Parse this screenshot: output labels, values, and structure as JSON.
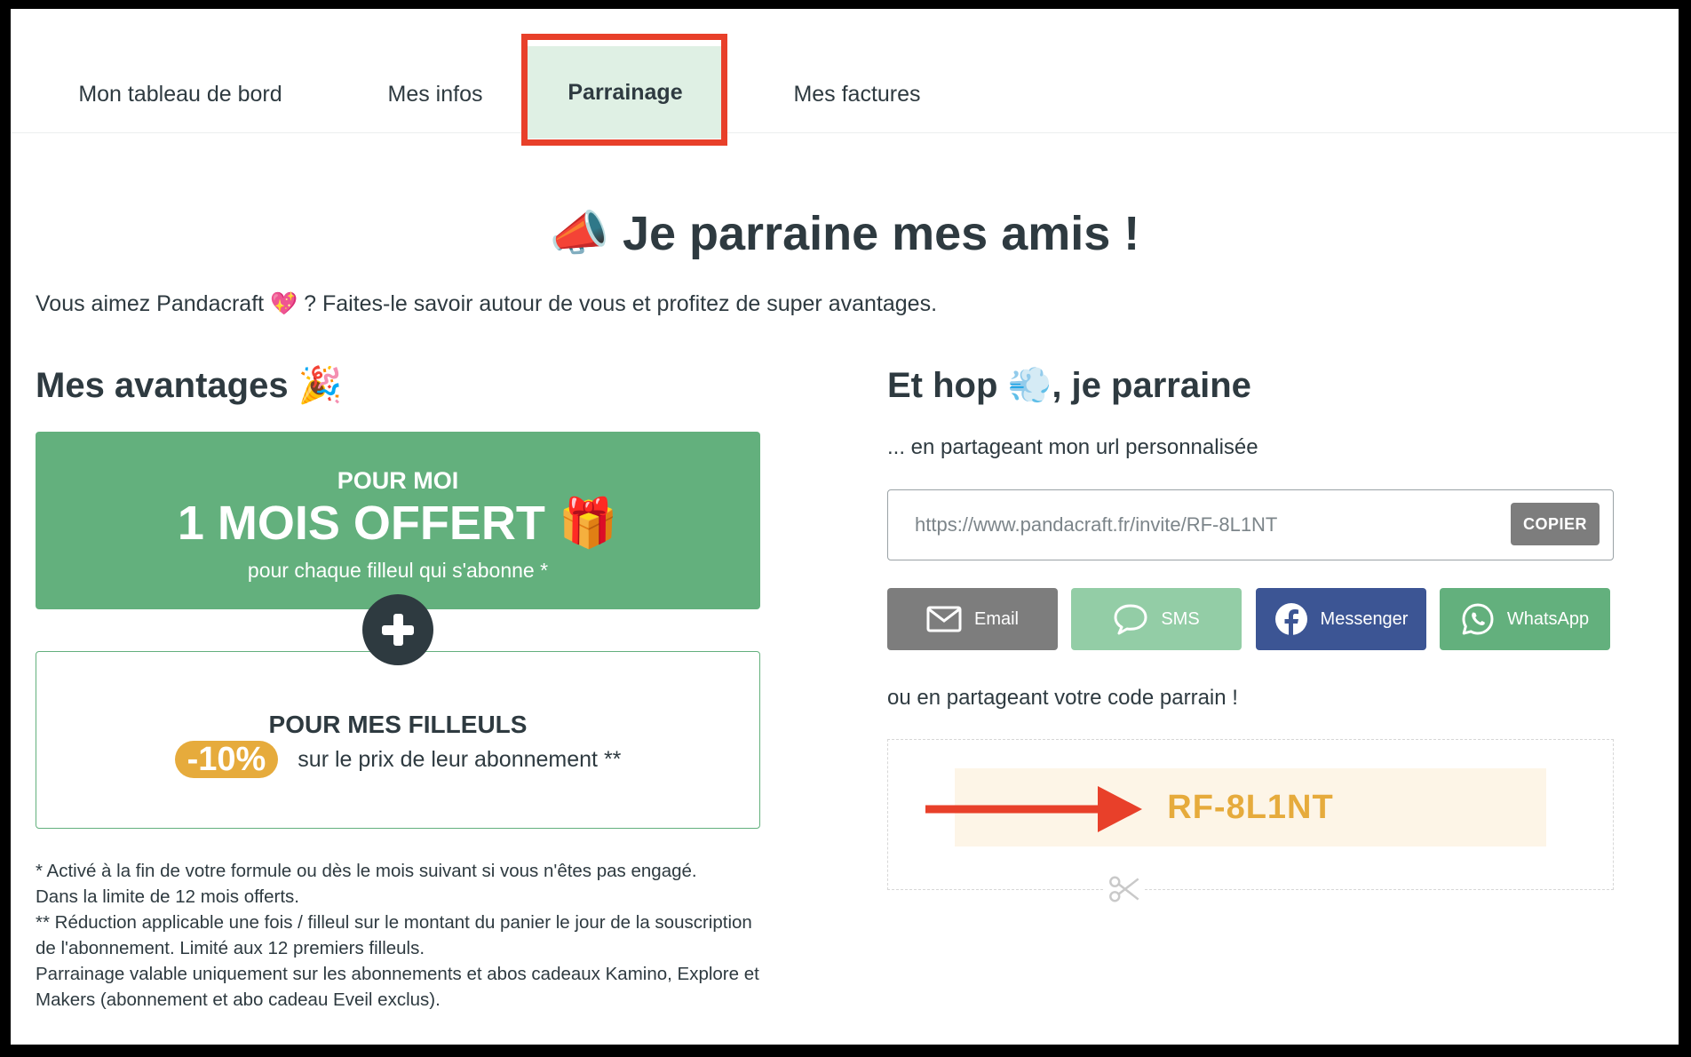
{
  "tabs": [
    {
      "label": "Mon tableau de bord"
    },
    {
      "label": "Mes infos"
    },
    {
      "label": "Parrainage"
    },
    {
      "label": "Mes factures"
    }
  ],
  "page": {
    "title": "📣 Je parraine mes amis !",
    "intro": "Vous aimez Pandacraft 💖 ? Faites-le savoir autour de vous et profitez de super avantages."
  },
  "avantages": {
    "heading": "Mes avantages 🎉",
    "me": {
      "label": "POUR MOI",
      "offer": "1 MOIS OFFERT 🎁",
      "sub": "pour chaque filleul qui s'abonne *"
    },
    "filleuls": {
      "label": "POUR MES FILLEULS",
      "badge": "-10%",
      "text": "sur le prix de leur abonnement **"
    },
    "notes": [
      "* Activé à la fin de votre formule ou dès le mois suivant si vous n'êtes pas engagé.",
      "Dans la limite de 12 mois offerts.",
      "** Réduction applicable une fois / filleul sur le montant du panier le jour de la souscription de l'abonnement. Limité aux 12 premiers filleuls.",
      "Parrainage valable uniquement sur les abonnements et abos cadeaux Kamino, Explore et Makers (abonnement et abo cadeau Eveil exclus)."
    ]
  },
  "share": {
    "heading": "Et hop 💨, je parraine",
    "url_label": "... en partageant mon url personnalisée",
    "url_value": "https://www.pandacraft.fr/invite/RF-8L1NT",
    "copy_label": "COPIER",
    "buttons": {
      "email": "Email",
      "sms": "SMS",
      "messenger": "Messenger",
      "whatsapp": "WhatsApp"
    },
    "code_label": "ou en partageant votre code parrain !",
    "code": "RF-8L1NT"
  },
  "colors": {
    "green": "#63b07d",
    "dark": "#2e3a40",
    "orange": "#e6ab3c",
    "highlight_red": "#e8402a",
    "messenger_blue": "#3c5594"
  }
}
